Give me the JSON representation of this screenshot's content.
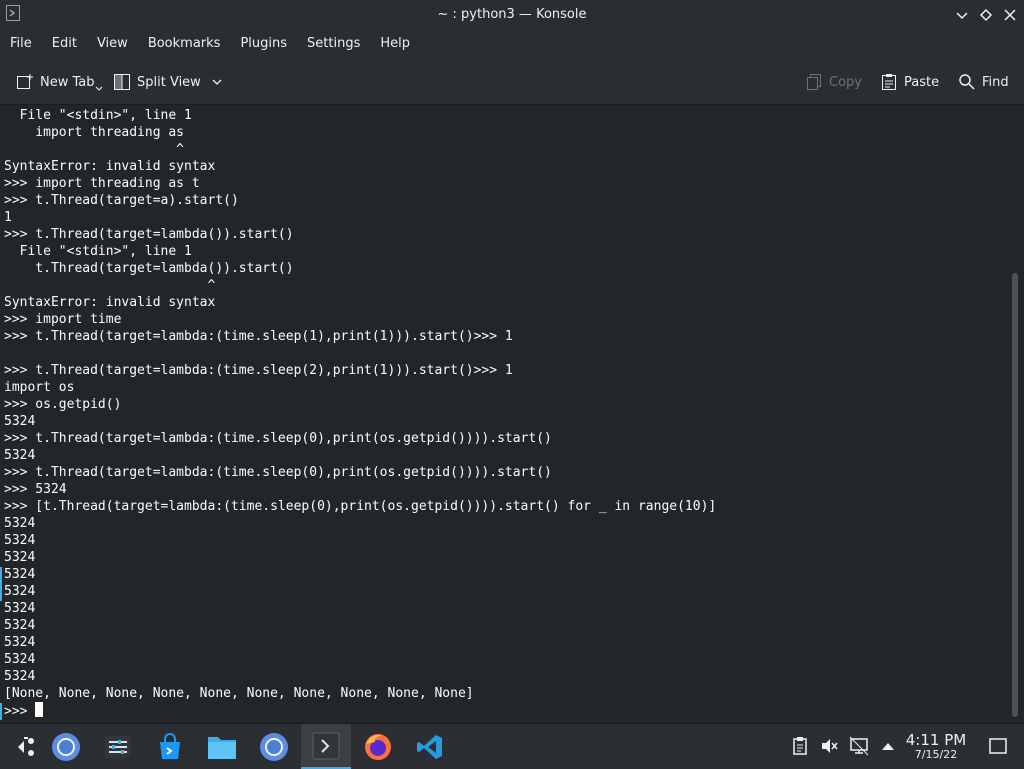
{
  "window": {
    "title": "~ : python3 — Konsole"
  },
  "menubar": {
    "items": [
      "File",
      "Edit",
      "View",
      "Bookmarks",
      "Plugins",
      "Settings",
      "Help"
    ]
  },
  "toolbar": {
    "new_tab": "New Tab",
    "split_view": "Split View",
    "copy": "Copy",
    "paste": "Paste",
    "find": "Find"
  },
  "terminal": {
    "lines": [
      "  File \"<stdin>\", line 1",
      "    import threading as",
      "                      ^",
      "SyntaxError: invalid syntax",
      ">>> import threading as t",
      ">>> t.Thread(target=a).start()",
      "1",
      ">>> t.Thread(target=lambda()).start()",
      "  File \"<stdin>\", line 1",
      "    t.Thread(target=lambda()).start()",
      "                          ^",
      "SyntaxError: invalid syntax",
      ">>> import time",
      ">>> t.Thread(target=lambda:(time.sleep(1),print(1))).start()>>> 1",
      "",
      ">>> t.Thread(target=lambda:(time.sleep(2),print(1))).start()>>> 1",
      "import os",
      ">>> os.getpid()",
      "5324",
      ">>> t.Thread(target=lambda:(time.sleep(0),print(os.getpid()))).start()",
      "5324",
      ">>> t.Thread(target=lambda:(time.sleep(0),print(os.getpid()))).start()",
      ">>> 5324",
      ">>> [t.Thread(target=lambda:(time.sleep(0),print(os.getpid()))).start() for _ in range(10)]",
      "5324",
      "5324",
      "5324",
      "5324",
      "5324",
      "5324",
      "5324",
      "5324",
      "5324",
      "5324",
      "[None, None, None, None, None, None, None, None, None, None]"
    ],
    "prompt": ">>> "
  },
  "taskbar": {
    "tasks": [
      "application-launcher",
      "chromium",
      "system-settings",
      "discover-store",
      "file-manager",
      "chromium",
      "konsole",
      "firefox",
      "vscode"
    ],
    "clock_time": "4:11 PM",
    "clock_date": "7/15/22"
  },
  "colors": {
    "accent": "#3daee9",
    "terminal_bg": "#232629",
    "chrome_bg": "#2a2e32"
  }
}
